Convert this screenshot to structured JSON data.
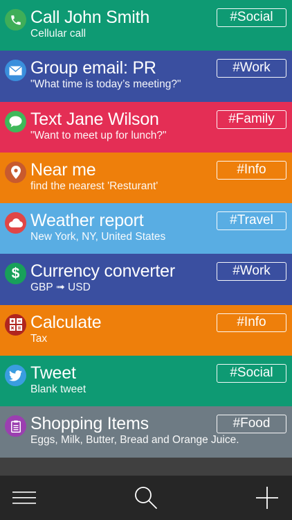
{
  "items": [
    {
      "title": "Call John Smith",
      "subtitle": "Cellular call",
      "tag": "#Social",
      "color": "#0e9a73",
      "icon": "phone-icon",
      "icon_bg": "#3fae58"
    },
    {
      "title": "Group email: PR",
      "subtitle": "\"What time is today’s meeting?\"",
      "tag": "#Work",
      "color": "#3a4fa0",
      "icon": "mail-icon",
      "icon_bg": "#3a8fdc"
    },
    {
      "title": "Text Jane Wilson",
      "subtitle": "\"Want to meet up for lunch?\"",
      "tag": "#Family",
      "color": "#e42e55",
      "icon": "chat-bubble-icon",
      "icon_bg": "#3fb85a"
    },
    {
      "title": "Near me",
      "subtitle": "find the nearest 'Resturant'",
      "tag": "#Info",
      "color": "#ee7f0b",
      "icon": "map-pin-icon",
      "icon_bg": "#c85a2e"
    },
    {
      "title": "Weather report",
      "subtitle": "New York, NY, United States",
      "tag": "#Travel",
      "color": "#59ade3",
      "icon": "cloud-icon",
      "icon_bg": "#e04646"
    },
    {
      "title": "Currency converter",
      "subtitle": "GBP ➟ USD",
      "tag": "#Work",
      "color": "#3a4fa0",
      "icon": "dollar-icon",
      "icon_bg": "#18a05a"
    },
    {
      "title": "Calculate",
      "subtitle": "Tax",
      "tag": "#Info",
      "color": "#ee7f0b",
      "icon": "calculator-icon",
      "icon_bg": "#b0251f"
    },
    {
      "title": "Tweet",
      "subtitle": "Blank tweet",
      "tag": "#Social",
      "color": "#0e9a73",
      "icon": "twitter-bird-icon",
      "icon_bg": "#3a9de0"
    },
    {
      "title": "Shopping Items",
      "subtitle": "Eggs, Milk, Butter, Bread and Orange Juice.",
      "tag": "#Food",
      "color": "#6e7b84",
      "icon": "list-icon",
      "icon_bg": "#9b3fb0"
    }
  ],
  "toolbar": {
    "menu_icon": "hamburger-menu-icon",
    "search_icon": "search-icon",
    "add_icon": "plus-icon"
  }
}
